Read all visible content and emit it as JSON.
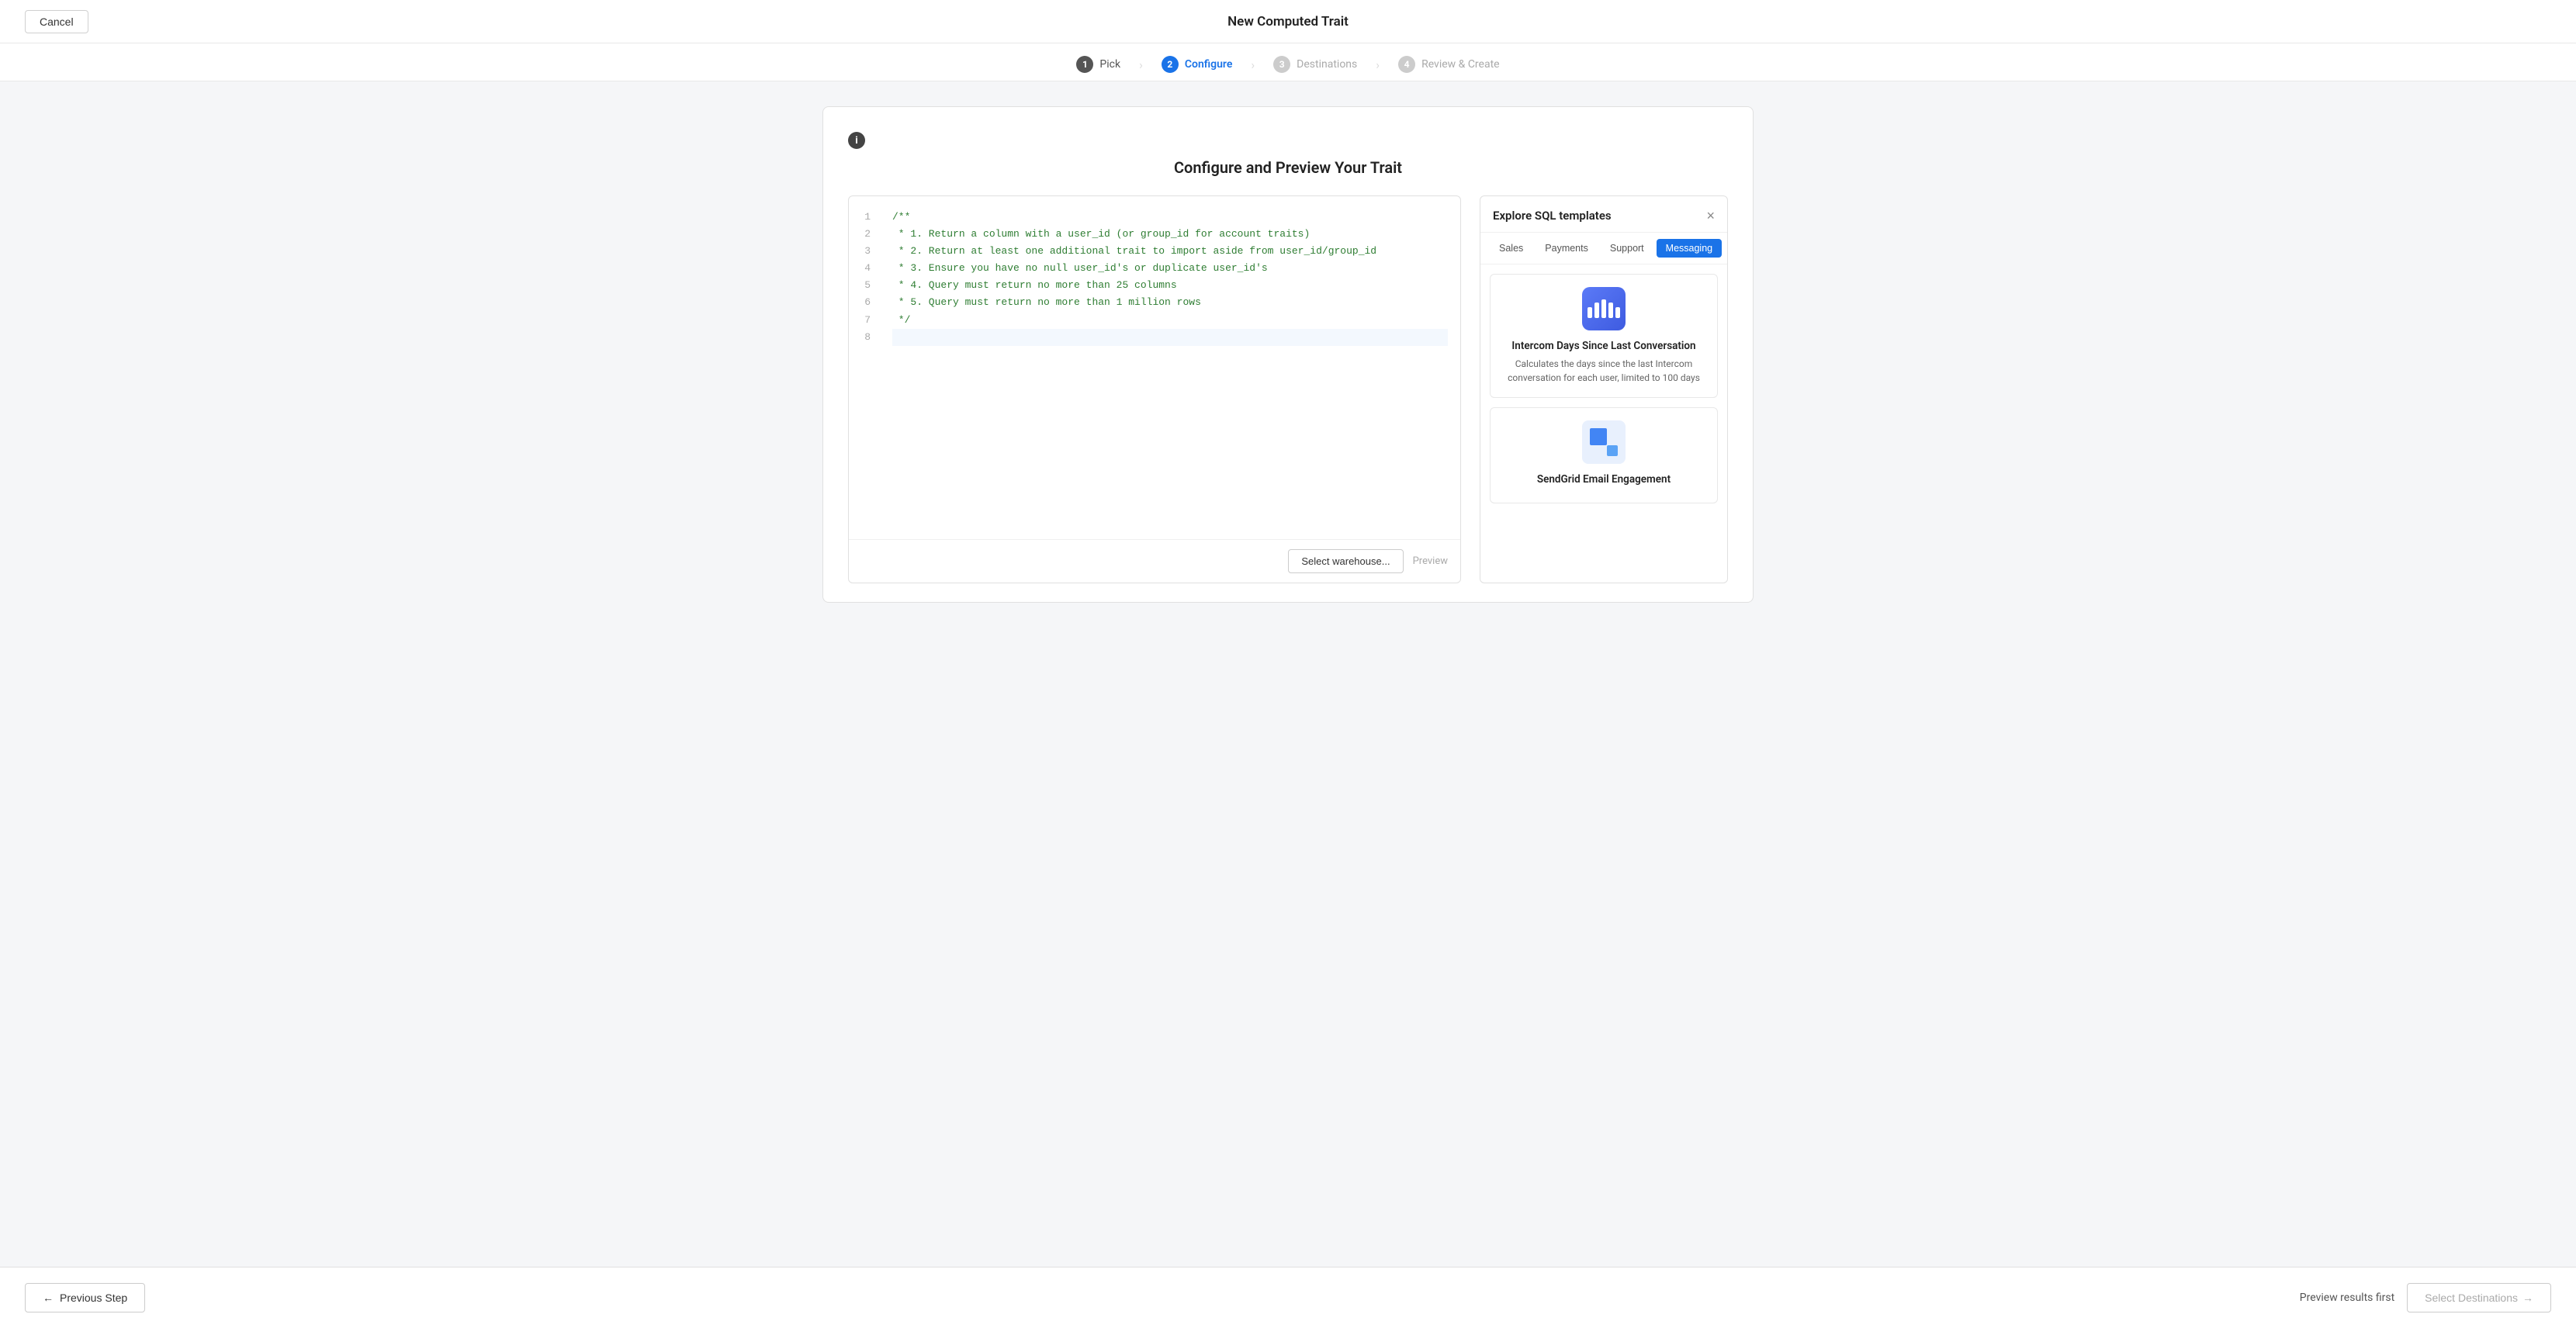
{
  "header": {
    "cancel_label": "Cancel",
    "title": "New Computed Trait"
  },
  "stepper": {
    "steps": [
      {
        "number": "1",
        "label": "Pick",
        "state": "completed"
      },
      {
        "number": "2",
        "label": "Configure",
        "state": "active"
      },
      {
        "number": "3",
        "label": "Destinations",
        "state": "upcoming"
      },
      {
        "number": "4",
        "label": "Review & Create",
        "state": "upcoming"
      }
    ]
  },
  "configure": {
    "title": "Configure and Preview Your Trait",
    "info_icon": "i",
    "code_lines": [
      {
        "number": "1",
        "text": "/**",
        "highlighted": false
      },
      {
        "number": "2",
        "text": " * 1. Return a column with a user_id (or group_id for account traits)",
        "highlighted": false
      },
      {
        "number": "3",
        "text": " * 2. Return at least one additional trait to import aside from user_id/group_id",
        "highlighted": false
      },
      {
        "number": "4",
        "text": " * 3. Ensure you have no null user_id's or duplicate user_id's",
        "highlighted": false
      },
      {
        "number": "5",
        "text": " * 4. Query must return no more than 25 columns",
        "highlighted": false
      },
      {
        "number": "6",
        "text": " * 5. Query must return no more than 1 million rows",
        "highlighted": false
      },
      {
        "number": "7",
        "text": " */",
        "highlighted": false
      },
      {
        "number": "8",
        "text": "",
        "highlighted": true
      }
    ],
    "warehouse_btn": "Select warehouse...",
    "preview_btn": "Preview"
  },
  "sql_panel": {
    "title": "Explore SQL templates",
    "close_label": "×",
    "tabs": [
      {
        "label": "Sales",
        "active": false
      },
      {
        "label": "Payments",
        "active": false
      },
      {
        "label": "Support",
        "active": false
      },
      {
        "label": "Messaging",
        "active": true
      }
    ],
    "templates": [
      {
        "id": "intercom",
        "name": "Intercom Days Since Last Conversation",
        "description": "Calculates the days since the last Intercom conversation for each user, limited to 100 days"
      },
      {
        "id": "sendgrid",
        "name": "SendGrid Email Engagement",
        "description": ""
      }
    ]
  },
  "bottom_bar": {
    "prev_label": "Previous Step",
    "preview_results_label": "Preview results first",
    "select_dest_label": "Select Destinations"
  }
}
